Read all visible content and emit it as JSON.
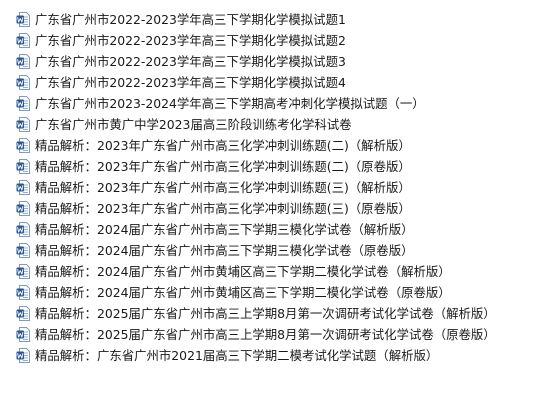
{
  "files": [
    {
      "icon": "word-document-icon",
      "name": "广东省广州市2022-2023学年高三下学期化学模拟试题1"
    },
    {
      "icon": "word-document-icon",
      "name": "广东省广州市2022-2023学年高三下学期化学模拟试题2"
    },
    {
      "icon": "word-document-icon",
      "name": "广东省广州市2022-2023学年高三下学期化学模拟试题3"
    },
    {
      "icon": "word-document-icon",
      "name": "广东省广州市2022-2023学年高三下学期化学模拟试题4"
    },
    {
      "icon": "word-document-icon",
      "name": "广东省广州市2023-2024学年高三下学期高考冲刺化学模拟试题（一）"
    },
    {
      "icon": "word-document-icon",
      "name": "广东省广州市黄广中学2023届高三阶段训练考化学科试卷"
    },
    {
      "icon": "word-document-icon",
      "name": "精品解析：2023年广东省广州市高三化学冲刺训练题(二)（解析版）"
    },
    {
      "icon": "word-document-icon",
      "name": "精品解析：2023年广东省广州市高三化学冲刺训练题(二)（原卷版）"
    },
    {
      "icon": "word-document-icon",
      "name": "精品解析：2023年广东省广州市高三化学冲刺训练题(三)（解析版）"
    },
    {
      "icon": "word-document-icon",
      "name": "精品解析：2023年广东省广州市高三化学冲刺训练题(三)（原卷版）"
    },
    {
      "icon": "word-document-icon",
      "name": "精品解析：2024届广东省广州市高三下学期三模化学试卷（解析版）"
    },
    {
      "icon": "word-document-icon",
      "name": "精品解析：2024届广东省广州市高三下学期三模化学试卷（原卷版）"
    },
    {
      "icon": "word-document-icon",
      "name": "精品解析：2024届广东省广州市黄埔区高三下学期二模化学试卷（解析版）"
    },
    {
      "icon": "word-document-icon",
      "name": "精品解析：2024届广东省广州市黄埔区高三下学期二模化学试卷（原卷版）"
    },
    {
      "icon": "word-document-icon",
      "name": "精品解析：2025届广东省广州市高三上学期8月第一次调研考试化学试卷（解析版）"
    },
    {
      "icon": "word-document-icon",
      "name": "精品解析：2025届广东省广州市高三上学期8月第一次调研考试化学试卷（原卷版）"
    },
    {
      "icon": "word-document-icon",
      "name": "精品解析：广东省广州市2021届高三下学期二模考试化学试题（解析版）"
    }
  ],
  "colors": {
    "icon_blue": "#2b579a",
    "icon_page": "#ffffff",
    "icon_border": "#7a9cc6",
    "text": "#1a1a1a"
  }
}
